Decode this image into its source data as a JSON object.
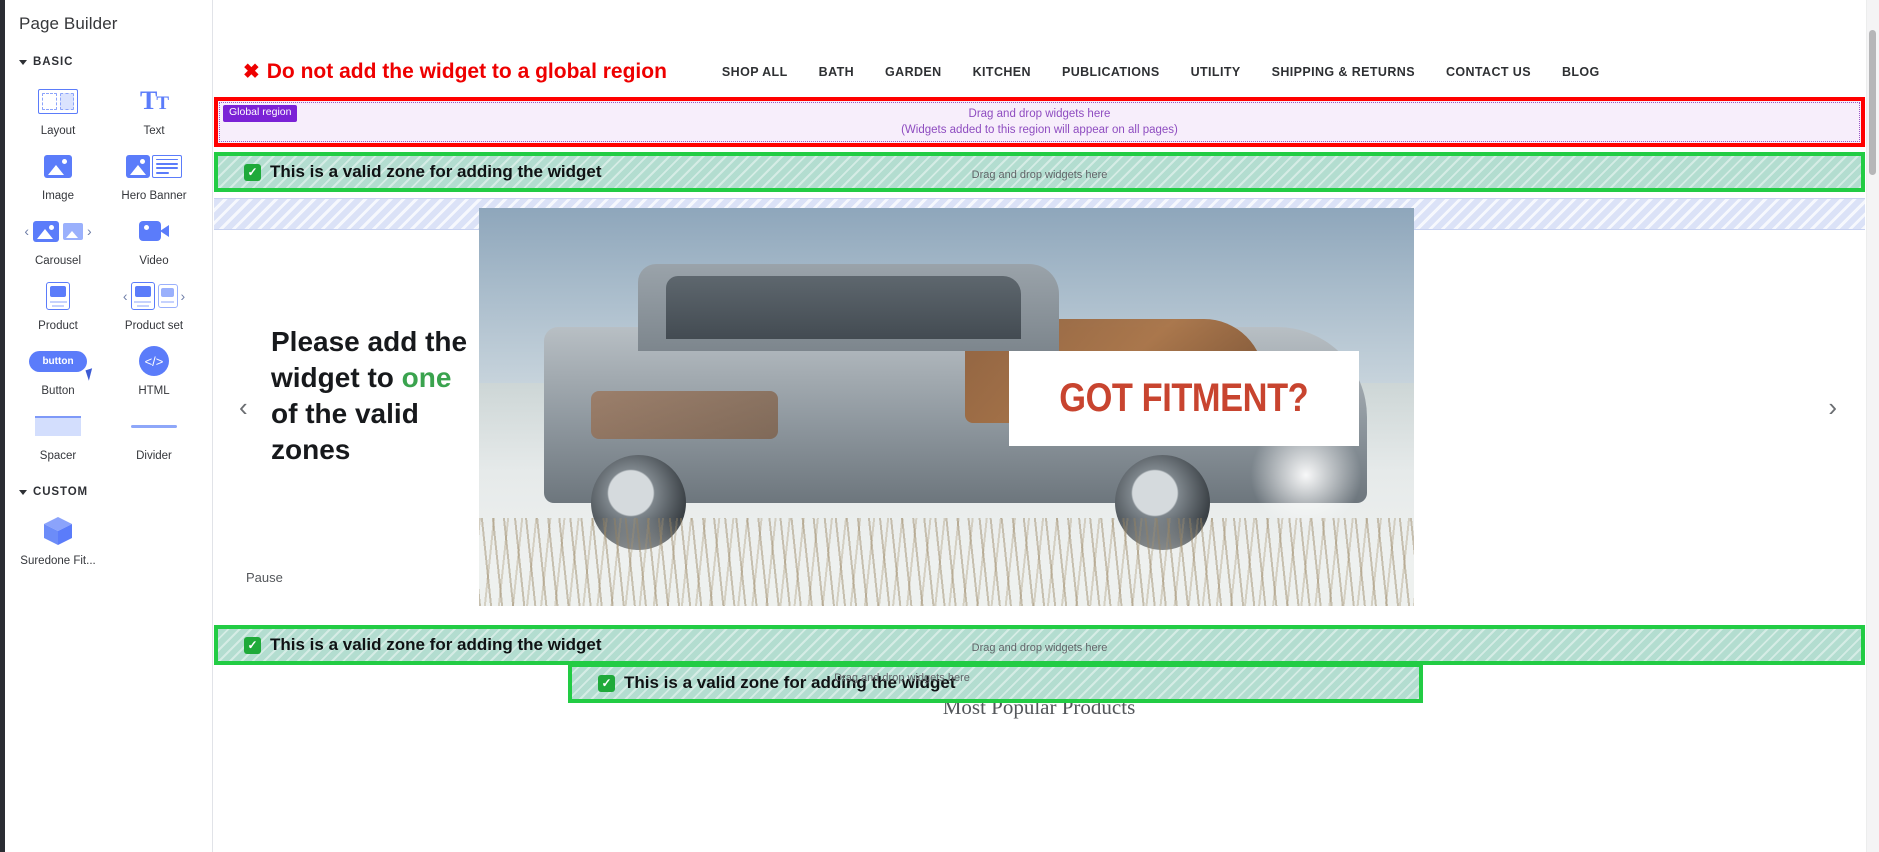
{
  "sidebar": {
    "title": "Page Builder",
    "sections": [
      {
        "label": "BASIC",
        "items": [
          {
            "label": "Layout",
            "icon": "layout-icon"
          },
          {
            "label": "Text",
            "icon": "text-icon"
          },
          {
            "label": "Image",
            "icon": "image-icon"
          },
          {
            "label": "Hero Banner",
            "icon": "hero-banner-icon"
          },
          {
            "label": "Carousel",
            "icon": "carousel-icon"
          },
          {
            "label": "Video",
            "icon": "video-icon"
          },
          {
            "label": "Product",
            "icon": "product-icon"
          },
          {
            "label": "Product set",
            "icon": "product-set-icon"
          },
          {
            "label": "Button",
            "icon": "button-icon"
          },
          {
            "label": "HTML",
            "icon": "html-icon"
          },
          {
            "label": "Spacer",
            "icon": "spacer-icon"
          },
          {
            "label": "Divider",
            "icon": "divider-icon"
          }
        ]
      },
      {
        "label": "CUSTOM",
        "items": [
          {
            "label": "Suredone Fit...",
            "icon": "cube-icon"
          }
        ]
      }
    ],
    "button_icon_label": "button"
  },
  "header": {
    "warning_mark": "✖",
    "warning_text": "Do not add the widget to a global region",
    "nav": [
      "SHOP ALL",
      "BATH",
      "GARDEN",
      "KITCHEN",
      "PUBLICATIONS",
      "UTILITY",
      "SHIPPING & RETURNS",
      "CONTACT US",
      "BLOG"
    ]
  },
  "global_region": {
    "badge": "Global region",
    "drop_text": "Drag and drop widgets here",
    "note": "(Widgets added to this region will appear on all pages)"
  },
  "valid_zones": [
    {
      "tick": "✓",
      "label": "This is a valid zone for adding the widget",
      "drop_text": "Drag and drop widgets here"
    },
    {
      "tick": "✓",
      "label": "This is a valid zone for adding the widget",
      "drop_text": "Drag and drop widgets here"
    },
    {
      "tick": "✓",
      "label": "This is a valid zone for adding the widget",
      "drop_text": "Drag and drop widgets here"
    }
  ],
  "hero": {
    "headline_part1": "Please add the widget to ",
    "headline_highlight": "one",
    "headline_part2": " of the valid zones",
    "fitment_text": "GOT FITMENT?",
    "pause_label": "Pause",
    "prev_arrow": "‹",
    "next_arrow": "›"
  },
  "popular": {
    "title": "Most Popular Products"
  },
  "colors": {
    "warning_red": "#ee0000",
    "valid_green": "#22cc44",
    "global_purple": "#7b22d6",
    "accent_blue": "#5b7cfa",
    "fitment_red": "#c8442f"
  }
}
